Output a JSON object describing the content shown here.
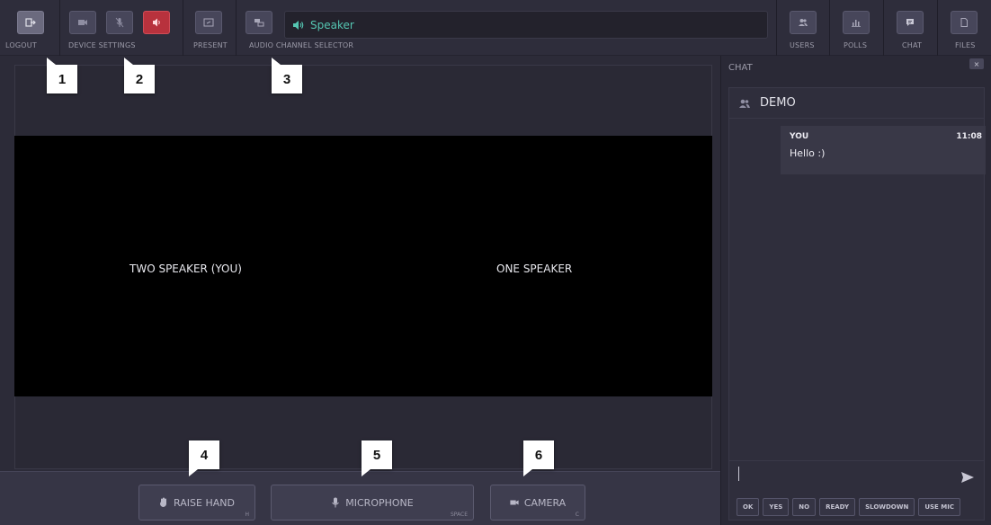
{
  "toolbar": {
    "logout_label": "LOGOUT",
    "device_settings_label": "DEVICE SETTINGS",
    "present_label": "PRESENT",
    "audio_channel_label": "AUDIO CHANNEL SELECTOR",
    "audio_channel_value": "Speaker",
    "users_label": "USERS",
    "polls_label": "POLLS",
    "chat_label": "CHAT",
    "files_label": "FILES"
  },
  "video": {
    "left_speaker": "TWO SPEAKER (YOU)",
    "right_speaker": "ONE SPEAKER"
  },
  "controls": {
    "raise_hand": {
      "label": "RAISE HAND",
      "shortcut": "H"
    },
    "microphone": {
      "label": "MICROPHONE",
      "shortcut": "SPACE"
    },
    "camera": {
      "label": "CAMERA",
      "shortcut": "C"
    }
  },
  "markers": [
    "1",
    "2",
    "3",
    "4",
    "5",
    "6"
  ],
  "chat": {
    "title": "CHAT",
    "close_glyph": "×",
    "room_name": "DEMO",
    "messages": [
      {
        "author": "YOU",
        "time": "11:08",
        "text": "Hello :)"
      }
    ],
    "quick_replies": [
      "OK",
      "YES",
      "NO",
      "READY",
      "SLOWDOWN",
      "USE MIC"
    ]
  },
  "colors": {
    "accent_teal": "#55c6b2",
    "danger_red": "#b8323d",
    "background": "#2b2a37"
  },
  "icons": {
    "logout": "logout-icon",
    "camera": "camera-icon",
    "mic_off": "mic-off-icon",
    "speaker": "speaker-icon",
    "present": "present-icon",
    "channel": "channel-icon",
    "users": "users-icon",
    "polls": "polls-icon",
    "chat": "chat-icon",
    "files": "files-icon",
    "send": "send-icon"
  }
}
